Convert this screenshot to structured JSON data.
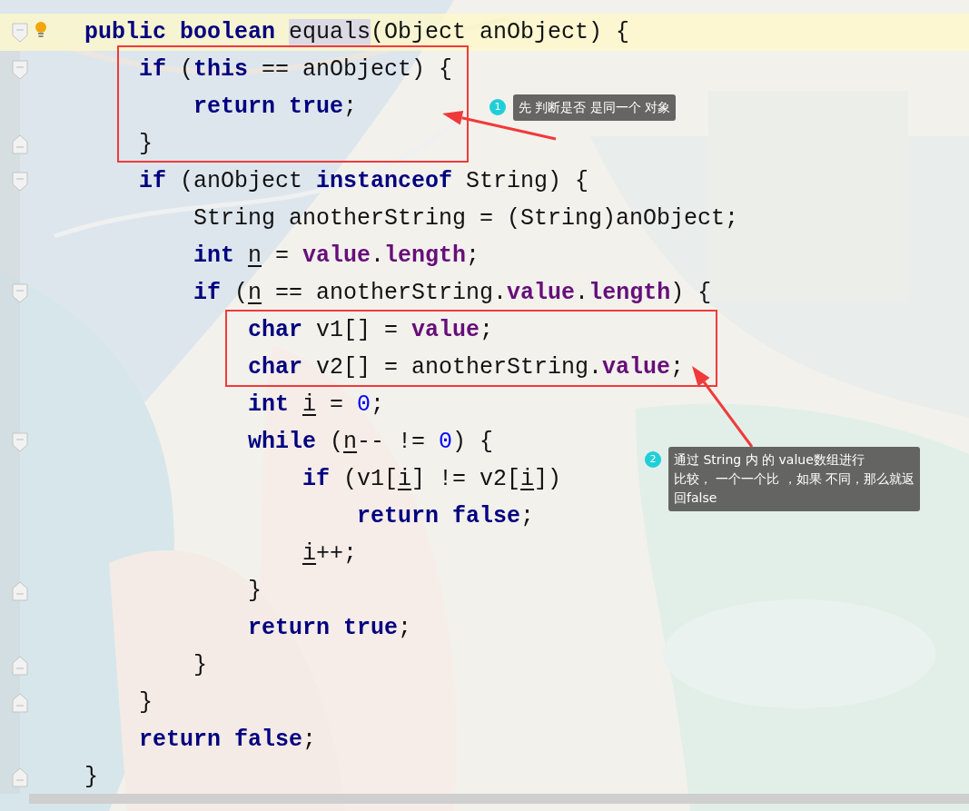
{
  "editor": {
    "lines": [
      {
        "current": true,
        "fold_start": true,
        "fold_end": false,
        "bulb": true,
        "tokens": [
          {
            "kind": "kw",
            "text": "public "
          },
          {
            "kind": "kw",
            "text": "boolean "
          },
          {
            "kind": "method",
            "text": "equals"
          },
          {
            "kind": "plain",
            "text": "(Object anObject) {"
          }
        ]
      },
      {
        "current": false,
        "fold_start": true,
        "fold_end": false,
        "bulb": false,
        "tokens": [
          {
            "kind": "kw",
            "text": "    if"
          },
          {
            "kind": "plain",
            "text": " ("
          },
          {
            "kind": "kw",
            "text": "this"
          },
          {
            "kind": "plain",
            "text": " == anObject) {"
          }
        ]
      },
      {
        "current": false,
        "fold_start": false,
        "fold_end": false,
        "bulb": false,
        "tokens": [
          {
            "kind": "kw",
            "text": "        return true"
          },
          {
            "kind": "plain",
            "text": ";"
          }
        ]
      },
      {
        "current": false,
        "fold_start": false,
        "fold_end": true,
        "bulb": false,
        "tokens": [
          {
            "kind": "plain",
            "text": "    }"
          }
        ]
      },
      {
        "current": false,
        "fold_start": true,
        "fold_end": false,
        "bulb": false,
        "tokens": [
          {
            "kind": "kw",
            "text": "    if"
          },
          {
            "kind": "plain",
            "text": " (anObject "
          },
          {
            "kind": "kw",
            "text": "instanceof"
          },
          {
            "kind": "plain",
            "text": " String) {"
          }
        ]
      },
      {
        "current": false,
        "fold_start": false,
        "fold_end": false,
        "bulb": false,
        "tokens": [
          {
            "kind": "plain",
            "text": "        String anotherString = (String)anObject;"
          }
        ]
      },
      {
        "current": false,
        "fold_start": false,
        "fold_end": false,
        "bulb": false,
        "tokens": [
          {
            "kind": "kw",
            "text": "        int "
          },
          {
            "kind": "var",
            "text": "n"
          },
          {
            "kind": "plain",
            "text": " = "
          },
          {
            "kind": "field",
            "text": "value"
          },
          {
            "kind": "plain",
            "text": "."
          },
          {
            "kind": "field",
            "text": "length"
          },
          {
            "kind": "plain",
            "text": ";"
          }
        ]
      },
      {
        "current": false,
        "fold_start": true,
        "fold_end": false,
        "bulb": false,
        "tokens": [
          {
            "kind": "kw",
            "text": "        if"
          },
          {
            "kind": "plain",
            "text": " ("
          },
          {
            "kind": "var",
            "text": "n"
          },
          {
            "kind": "plain",
            "text": " == anotherString."
          },
          {
            "kind": "field",
            "text": "value"
          },
          {
            "kind": "plain",
            "text": "."
          },
          {
            "kind": "field",
            "text": "length"
          },
          {
            "kind": "plain",
            "text": ") {"
          }
        ]
      },
      {
        "current": false,
        "fold_start": false,
        "fold_end": false,
        "bulb": false,
        "tokens": [
          {
            "kind": "kw",
            "text": "            char"
          },
          {
            "kind": "plain",
            "text": " v1[] = "
          },
          {
            "kind": "field",
            "text": "value"
          },
          {
            "kind": "plain",
            "text": ";"
          }
        ]
      },
      {
        "current": false,
        "fold_start": false,
        "fold_end": false,
        "bulb": false,
        "tokens": [
          {
            "kind": "kw",
            "text": "            char"
          },
          {
            "kind": "plain",
            "text": " v2[] = anotherString."
          },
          {
            "kind": "field",
            "text": "value"
          },
          {
            "kind": "plain",
            "text": ";"
          }
        ]
      },
      {
        "current": false,
        "fold_start": false,
        "fold_end": false,
        "bulb": false,
        "tokens": [
          {
            "kind": "kw",
            "text": "            int "
          },
          {
            "kind": "var",
            "text": "i"
          },
          {
            "kind": "plain",
            "text": " = "
          },
          {
            "kind": "num",
            "text": "0"
          },
          {
            "kind": "plain",
            "text": ";"
          }
        ]
      },
      {
        "current": false,
        "fold_start": true,
        "fold_end": false,
        "bulb": false,
        "tokens": [
          {
            "kind": "kw",
            "text": "            while"
          },
          {
            "kind": "plain",
            "text": " ("
          },
          {
            "kind": "var",
            "text": "n"
          },
          {
            "kind": "plain",
            "text": "-- != "
          },
          {
            "kind": "num",
            "text": "0"
          },
          {
            "kind": "plain",
            "text": ") {"
          }
        ]
      },
      {
        "current": false,
        "fold_start": false,
        "fold_end": false,
        "bulb": false,
        "tokens": [
          {
            "kind": "kw",
            "text": "                if"
          },
          {
            "kind": "plain",
            "text": " (v1["
          },
          {
            "kind": "var",
            "text": "i"
          },
          {
            "kind": "plain",
            "text": "] != v2["
          },
          {
            "kind": "var",
            "text": "i"
          },
          {
            "kind": "plain",
            "text": "])"
          }
        ]
      },
      {
        "current": false,
        "fold_start": false,
        "fold_end": false,
        "bulb": false,
        "tokens": [
          {
            "kind": "kw",
            "text": "                    return false"
          },
          {
            "kind": "plain",
            "text": ";"
          }
        ]
      },
      {
        "current": false,
        "fold_start": false,
        "fold_end": false,
        "bulb": false,
        "tokens": [
          {
            "kind": "var",
            "text": "                i"
          },
          {
            "kind": "plain",
            "text": "++;"
          }
        ]
      },
      {
        "current": false,
        "fold_start": false,
        "fold_end": true,
        "bulb": false,
        "tokens": [
          {
            "kind": "plain",
            "text": "            }"
          }
        ]
      },
      {
        "current": false,
        "fold_start": false,
        "fold_end": false,
        "bulb": false,
        "tokens": [
          {
            "kind": "kw",
            "text": "            return true"
          },
          {
            "kind": "plain",
            "text": ";"
          }
        ]
      },
      {
        "current": false,
        "fold_start": false,
        "fold_end": true,
        "bulb": false,
        "tokens": [
          {
            "kind": "plain",
            "text": "        }"
          }
        ]
      },
      {
        "current": false,
        "fold_start": false,
        "fold_end": true,
        "bulb": false,
        "tokens": [
          {
            "kind": "plain",
            "text": "    }"
          }
        ]
      },
      {
        "current": false,
        "fold_start": false,
        "fold_end": false,
        "bulb": false,
        "tokens": [
          {
            "kind": "kw",
            "text": "    return false"
          },
          {
            "kind": "plain",
            "text": ";"
          }
        ]
      },
      {
        "current": false,
        "fold_start": false,
        "fold_end": true,
        "bulb": false,
        "tokens": [
          {
            "kind": "plain",
            "text": "}"
          }
        ]
      }
    ]
  },
  "annotations": [
    {
      "number": "1",
      "lines": [
        "先 判断是否 是同一个 对象"
      ]
    },
    {
      "number": "2",
      "lines": [
        "通过 String 内 的 value数组进行",
        "比较， 一个一个比 ，如果 不同，那么就返",
        "回false"
      ]
    }
  ]
}
